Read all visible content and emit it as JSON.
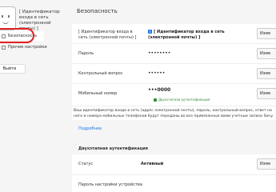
{
  "sidebar": {
    "user_id": "[ Идентификатор входа в сеть (электронной почты) ]",
    "items": [
      {
        "label": "Безопасность"
      },
      {
        "label": "Прочие настройки"
      }
    ],
    "logout_label": "Выйти"
  },
  "main": {
    "title": "Безопасность",
    "rows": [
      {
        "label": "[ Идентификатор входа в сеть (электронной почты) ]",
        "value": "[ Идентификатор входа в сеть (электронной почты) ]",
        "button": "Изме"
      },
      {
        "label": "Пароль",
        "value": "••••••••",
        "button": "Изме"
      },
      {
        "label": "Контрольный вопрос",
        "value": "••••••",
        "button": "Изме"
      },
      {
        "label": "Мобильный номер",
        "value": "•••0000",
        "note": "Двухэтапная аутентификация",
        "button": "Изме"
      }
    ],
    "info_text": "Ваш идентификатор входа в сеть (адрес электронной почты), пароль, контрольный вопрос, ответ на него и номера мобильных телефонов будут переданы во все привязанные вами учетные записи Sony.",
    "more_link": "Подробнее",
    "twofa": {
      "title": "Двухэтапная аутентификация",
      "status_label": "Статус",
      "status_value": "Активный",
      "button": "Изме",
      "device_pwd_label": "Пароль настройки устройства"
    }
  }
}
